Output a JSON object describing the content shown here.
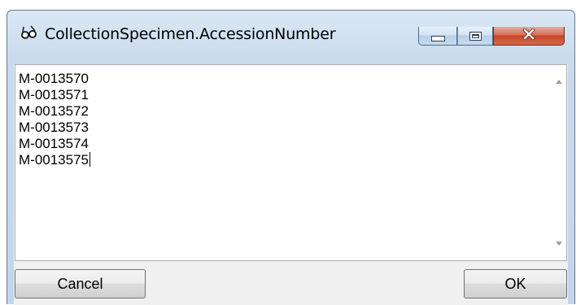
{
  "window": {
    "title": "CollectionSpecimen.AccessionNumber",
    "icon": "glasses-icon"
  },
  "caption_buttons": {
    "minimize": "minimize-icon",
    "maximize": "maximize-icon",
    "close": "close-icon",
    "close_glyph": "X"
  },
  "editor": {
    "lines": [
      "M-0013570",
      "M-0013571",
      "M-0013572",
      "M-0013573",
      "M-0013574",
      "M-0013575"
    ]
  },
  "buttons": {
    "cancel_label": "Cancel",
    "ok_label": "OK"
  },
  "colors": {
    "title_bar": "#c9daec",
    "close_button": "#c7452a",
    "client_background": "#f0f0f0"
  }
}
